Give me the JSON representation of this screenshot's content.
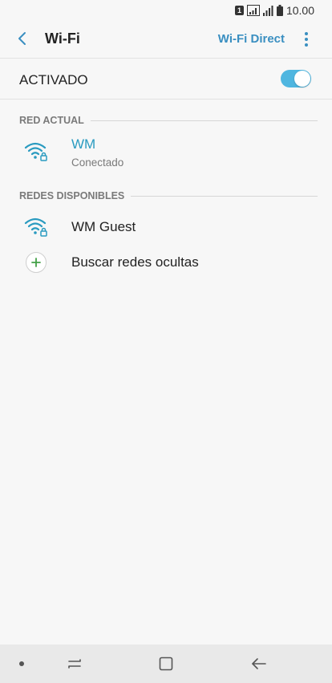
{
  "status_bar": {
    "sim_label": "1",
    "time": "10.00"
  },
  "header": {
    "title": "Wi-Fi",
    "wifi_direct_label": "Wi-Fi Direct"
  },
  "master_switch": {
    "label": "ACTIVADO",
    "on": true
  },
  "current_network_section": {
    "title": "RED ACTUAL",
    "network": {
      "name": "WM",
      "status": "Conectado"
    }
  },
  "available_section": {
    "title": "REDES DISPONIBLES",
    "networks": [
      {
        "name": "WM Guest"
      }
    ],
    "add_hidden_label": "Buscar redes ocultas"
  },
  "colors": {
    "accent": "#3a8fc1",
    "connected": "#2a9bc0",
    "toggle_on": "#4fb6e0",
    "add_icon": "#43a047"
  }
}
